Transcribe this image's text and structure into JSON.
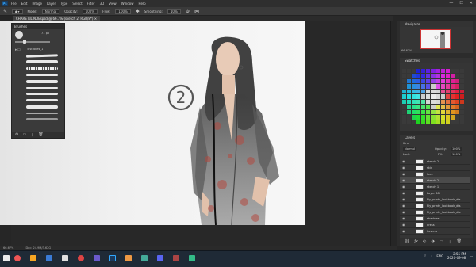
{
  "app": {
    "name": "Ps",
    "menu": [
      "File",
      "Edit",
      "Image",
      "Layer",
      "Type",
      "Select",
      "Filter",
      "3D",
      "View",
      "Window",
      "Help"
    ],
    "window_controls": [
      "—",
      "☐",
      "✕"
    ]
  },
  "options": {
    "mode_label": "Mode:",
    "mode_value": "Normal",
    "opacity_label": "Opacity:",
    "opacity_value": "100%",
    "flow_label": "Flow:",
    "flow_value": "100%",
    "smoothing_label": "Smoothing:",
    "smoothing_value": "10%"
  },
  "document": {
    "tab_title": "CHARE LIL NOEspsd @ 66.7% (sketch 2, RGB/8*) ×"
  },
  "brushes": {
    "title": "Brushes",
    "size_value": "71 px",
    "group_label": "5 strokes_1",
    "folder_icon": "folder-icon"
  },
  "navigator": {
    "title": "Navigator",
    "zoom": "66.67%"
  },
  "swatches": {
    "title": "Swatches"
  },
  "layers": {
    "title": "Layers",
    "kind_label": "Kind",
    "blend_mode": "Normal",
    "opacity_label": "Opacity:",
    "opacity_value": "100%",
    "lock_label": "Lock:",
    "fill_label": "Fill:",
    "fill_value": "100%",
    "rows": [
      {
        "name": "sketch 2",
        "selected": false
      },
      {
        "name": "skin",
        "selected": false
      },
      {
        "name": "face",
        "selected": false
      },
      {
        "name": "sketch 2",
        "selected": true
      },
      {
        "name": "sketch 1",
        "selected": false
      },
      {
        "name": "Layer 88",
        "selected": false
      },
      {
        "name": "Fly_prints_lookbook_dfs",
        "selected": false
      },
      {
        "name": "Fly_prints_lookbook_dfs",
        "selected": false
      },
      {
        "name": "Fly_prints_lookbook_dfs",
        "selected": false
      },
      {
        "name": "shadows",
        "selected": false
      },
      {
        "name": "dress",
        "selected": false
      },
      {
        "name": "flowers",
        "selected": false
      }
    ]
  },
  "canvas": {
    "annotation": "2"
  },
  "status": {
    "zoom": "66.67%",
    "doc": "Doc: 24.9M/3.62G"
  },
  "taskbar": {
    "clock_time": "2:55 PM",
    "clock_date": "2020-09-08",
    "lang": "ENG"
  },
  "colors": {
    "bg": "#262626",
    "panel": "#353535",
    "canvas": "#f2f2f2",
    "selected_layer": "#4b4b4b"
  }
}
